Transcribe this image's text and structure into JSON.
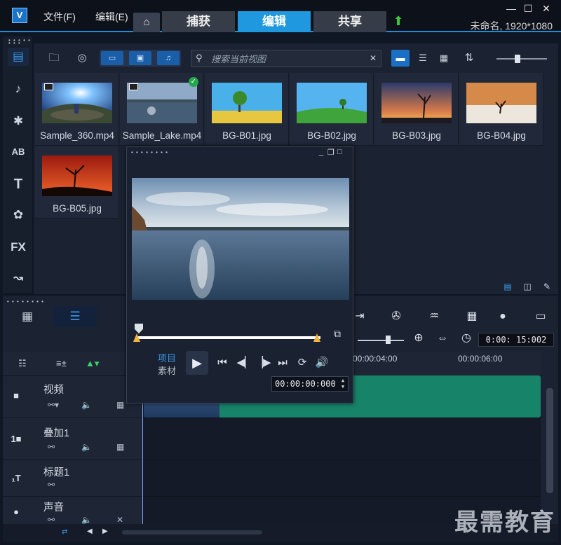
{
  "window": {
    "logo": "V",
    "menus": [
      "文件(F)",
      "编辑(E)"
    ],
    "tabs": [
      {
        "label": "捕获",
        "active": false
      },
      {
        "label": "编辑",
        "active": true
      },
      {
        "label": "共享",
        "active": false
      }
    ],
    "project_info": "未命名, 1920*1080",
    "controls": [
      "—",
      "☐",
      "✕"
    ]
  },
  "sidebar": {
    "items": [
      {
        "icon": "media-library-icon",
        "glyph": "▤",
        "active": true
      },
      {
        "icon": "audio-note-icon",
        "glyph": "♪",
        "active": false
      },
      {
        "icon": "instant-project-icon",
        "glyph": "✱",
        "active": false
      },
      {
        "icon": "transition-icon",
        "glyph": "AB",
        "active": false
      },
      {
        "icon": "title-icon",
        "glyph": "T",
        "active": false
      },
      {
        "icon": "graphic-icon",
        "glyph": "✿",
        "active": false
      },
      {
        "icon": "fx-icon",
        "glyph": "FX",
        "active": false
      },
      {
        "icon": "path-icon",
        "glyph": "↝",
        "active": false
      }
    ]
  },
  "library": {
    "search_placeholder": "搜索当前视图",
    "items": [
      {
        "label": "Sample_360.mp4",
        "type": "video",
        "checked": false
      },
      {
        "label": "Sample_Lake.mp4",
        "type": "video",
        "checked": true
      },
      {
        "label": "BG-B01.jpg",
        "type": "image",
        "checked": false
      },
      {
        "label": "BG-B02.jpg",
        "type": "image",
        "checked": false
      },
      {
        "label": "BG-B03.jpg",
        "type": "image",
        "checked": false
      },
      {
        "label": "BG-B04.jpg",
        "type": "image",
        "checked": false
      },
      {
        "label": "BG-B05.jpg",
        "type": "image",
        "checked": false
      }
    ]
  },
  "player": {
    "mode_project": "项目",
    "mode_clip": "素材",
    "timecode": "00:00:00:000",
    "trim_end_fraction": 0.98
  },
  "timeline": {
    "duration": "0:00: 15:002",
    "zoom_slider_fraction": 0.62,
    "ruler": [
      "00:00:04:00",
      "00:00:06:00"
    ],
    "tracks": [
      {
        "name": "视频",
        "icon": "video-track-icon",
        "glyph": "■"
      },
      {
        "name": "叠加1",
        "icon": "overlay-track-icon",
        "glyph": "1■"
      },
      {
        "name": "标题1",
        "icon": "title-track-icon",
        "glyph": "₁T"
      },
      {
        "name": "声音",
        "icon": "voice-track-icon",
        "glyph": "●"
      }
    ]
  },
  "watermark": "最需教育",
  "colors": {
    "accent": "#1f98e0",
    "clip": "#17846a",
    "trim": "#f2b340"
  }
}
